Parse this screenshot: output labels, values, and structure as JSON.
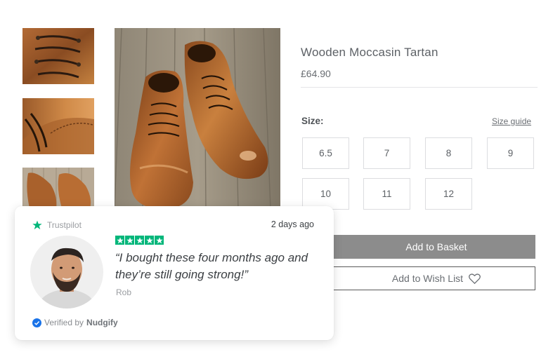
{
  "product": {
    "title": "Wooden Moccasin Tartan",
    "price": "£64.90",
    "size_label": "Size:",
    "size_guide": "Size guide",
    "sizes": [
      "6.5",
      "7",
      "8",
      "9",
      "10",
      "11",
      "12"
    ],
    "add_to_basket": "Add to Basket",
    "add_to_wishlist": "Add to Wish List"
  },
  "review": {
    "source": "Trustpilot",
    "date": "2 days ago",
    "rating": 5,
    "quote": "“I bought these four months ago and they’re still going strong!”",
    "author": "Rob",
    "verified_prefix": "Verified by",
    "verified_brand": "Nudgify"
  },
  "icons": {
    "trustpilot": "star-icon",
    "wishlist": "heart-icon",
    "verified": "check-circle-icon"
  },
  "colors": {
    "trustpilot_green": "#00b67a",
    "basket_button": "#8c8c8c",
    "verified_blue": "#1a73e8"
  }
}
